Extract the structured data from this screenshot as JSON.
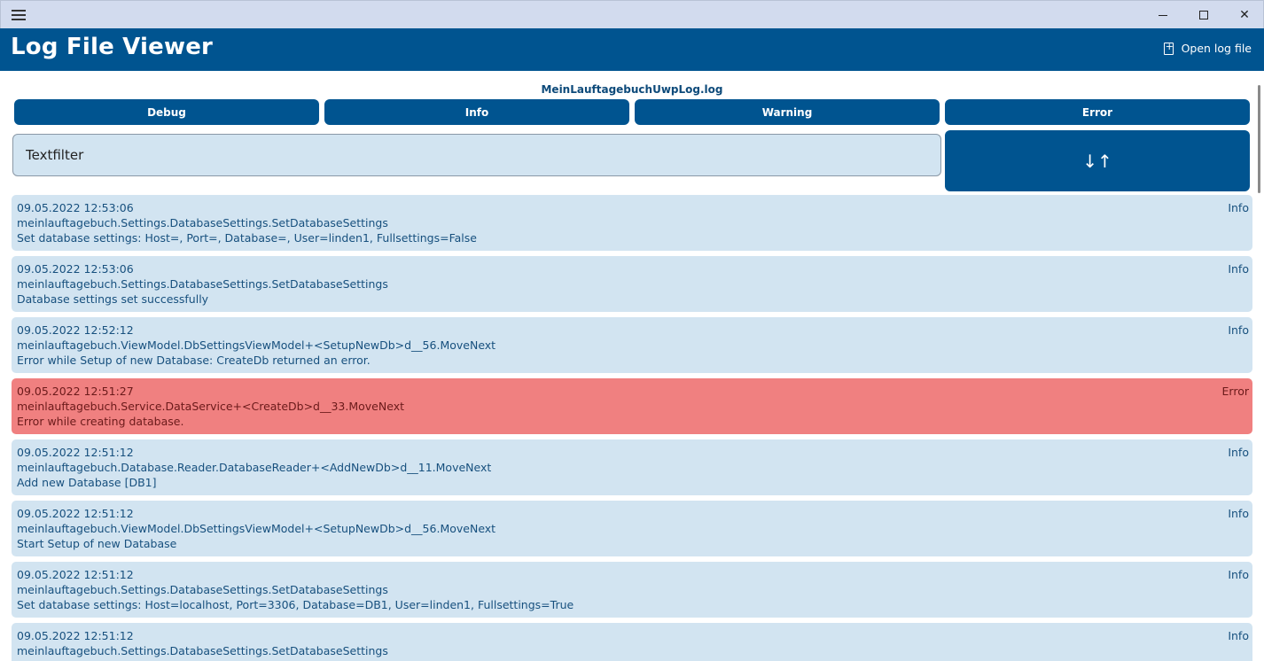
{
  "app": {
    "title": "Log File Viewer",
    "open_log_label": "Open log file",
    "file_name": "MeinLauftagebuchUwpLog.log"
  },
  "levels": {
    "debug": "Debug",
    "info": "Info",
    "warning": "Warning",
    "error": "Error"
  },
  "filter": {
    "placeholder": "Textfilter",
    "value": ""
  },
  "sort": {
    "icon": "↓↑"
  },
  "colors": {
    "accent": "#005490",
    "entry_bg": "#d2e4f1",
    "error_bg": "#f08080"
  },
  "entries": [
    {
      "timestamp": "09.05.2022 12:53:06",
      "source": "meinlauftagebuch.Settings.DatabaseSettings.SetDatabaseSettings",
      "message": "Set database settings: Host=, Port=, Database=, User=linden1, Fullsettings=False",
      "level": "Info"
    },
    {
      "timestamp": "09.05.2022 12:53:06",
      "source": "meinlauftagebuch.Settings.DatabaseSettings.SetDatabaseSettings",
      "message": "Database settings set successfully",
      "level": "Info"
    },
    {
      "timestamp": "09.05.2022 12:52:12",
      "source": "meinlauftagebuch.ViewModel.DbSettingsViewModel+<SetupNewDb>d__56.MoveNext",
      "message": "Error while Setup of new Database: CreateDb returned an error.",
      "level": "Info"
    },
    {
      "timestamp": "09.05.2022 12:51:27",
      "source": "meinlauftagebuch.Service.DataService+<CreateDb>d__33.MoveNext",
      "message": "Error while creating database.",
      "level": "Error"
    },
    {
      "timestamp": "09.05.2022 12:51:12",
      "source": "meinlauftagebuch.Database.Reader.DatabaseReader+<AddNewDb>d__11.MoveNext",
      "message": "Add new Database [DB1]",
      "level": "Info"
    },
    {
      "timestamp": "09.05.2022 12:51:12",
      "source": "meinlauftagebuch.ViewModel.DbSettingsViewModel+<SetupNewDb>d__56.MoveNext",
      "message": "Start Setup of new Database",
      "level": "Info"
    },
    {
      "timestamp": "09.05.2022 12:51:12",
      "source": "meinlauftagebuch.Settings.DatabaseSettings.SetDatabaseSettings",
      "message": "Set database settings: Host=localhost, Port=3306, Database=DB1, User=linden1, Fullsettings=True",
      "level": "Info"
    },
    {
      "timestamp": "09.05.2022 12:51:12",
      "source": "meinlauftagebuch.Settings.DatabaseSettings.SetDatabaseSettings",
      "message": "",
      "level": "Info"
    }
  ]
}
